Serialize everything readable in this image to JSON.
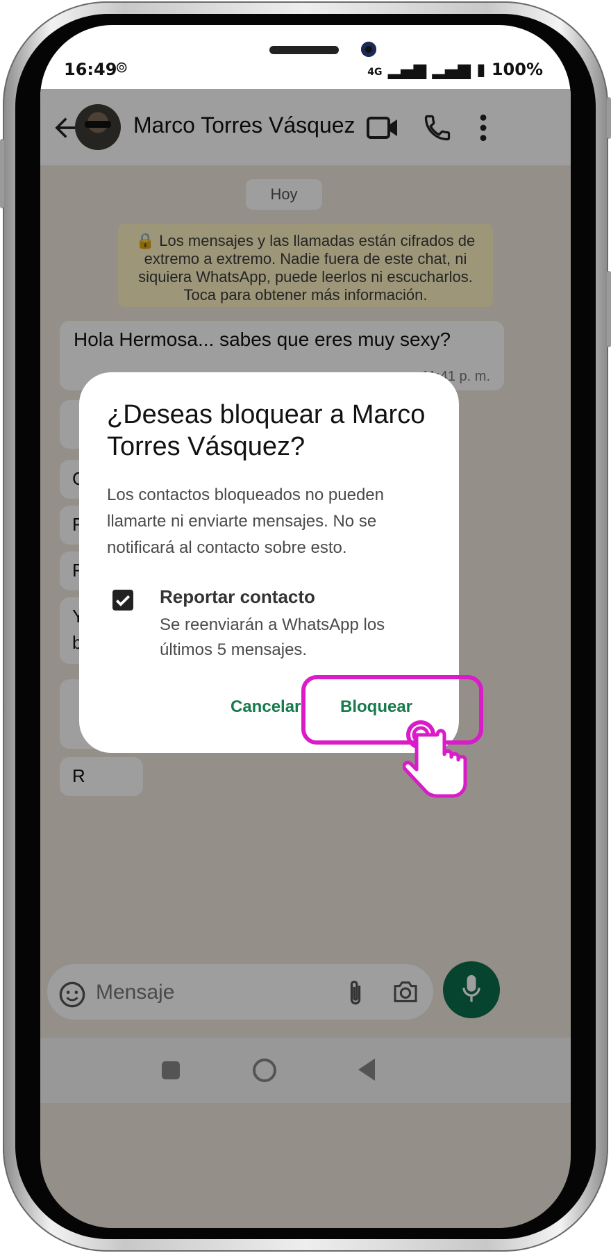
{
  "status_bar": {
    "time": "16:49",
    "signal_text": "4G",
    "battery": "100%"
  },
  "header": {
    "contact_name": "Marco Torres Vásquez"
  },
  "chat": {
    "date_chip": "Hoy",
    "encryption_notice": "🔒 Los mensajes y las llamadas están cifrados de extremo a extremo. Nadie fuera de este chat, ni siquiera WhatsApp, puede leerlos ni escucharlos. Toca para obtener más información.",
    "first_message": {
      "text": "Hola Hermosa... sabes que eres muy sexy?",
      "time": "11:41 p. m."
    },
    "partial_messages": [
      "C",
      "F",
      "R",
      "Y",
      "b",
      "R"
    ]
  },
  "dialog": {
    "title": "¿Deseas bloquear a Marco Torres Vásquez?",
    "body": "Los contactos bloqueados no pueden llamarte ni enviarte mensajes. No se notificará al contacto sobre esto.",
    "checkbox_checked": true,
    "checkbox_label": "Reportar contacto",
    "checkbox_description": "Se reenviarán a WhatsApp los últimos 5 mensajes.",
    "cancel_label": "Cancelar",
    "block_label": "Bloquear"
  },
  "composer": {
    "placeholder": "Mensaje"
  },
  "colors": {
    "accent": "#177a4b",
    "highlight": "#d91bc8",
    "encryption_bg": "#fdf3c4"
  }
}
